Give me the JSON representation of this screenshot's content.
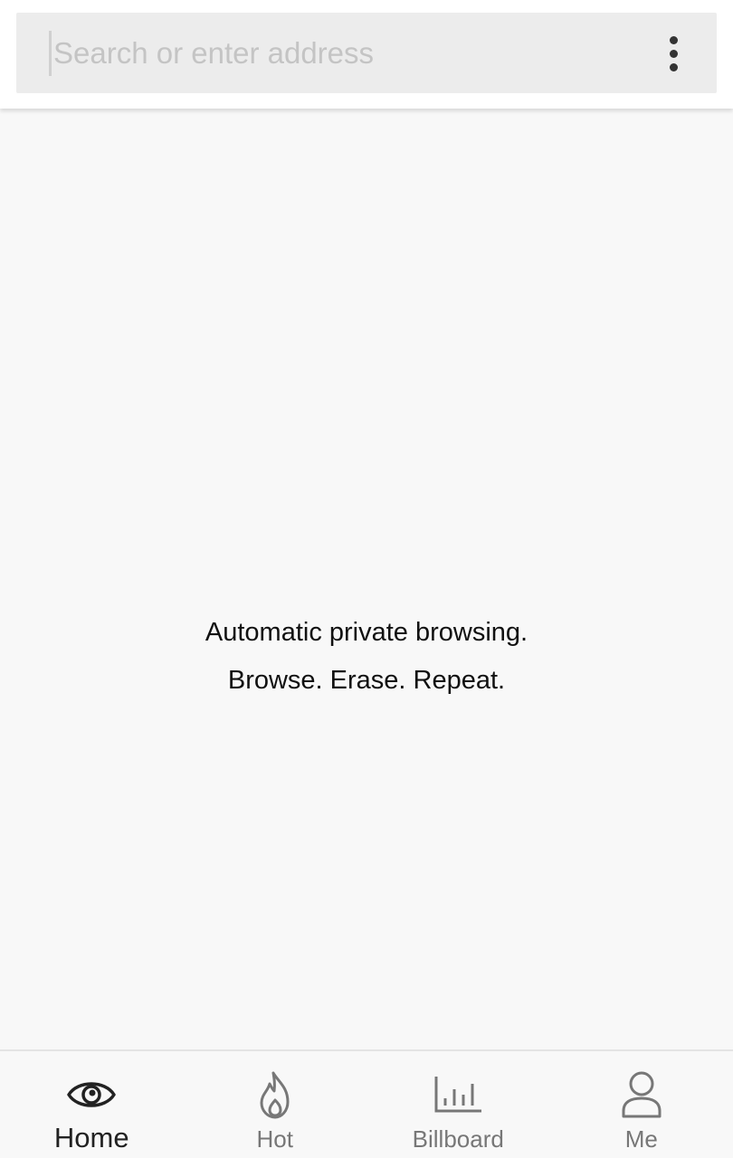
{
  "search": {
    "placeholder": "Search or enter address",
    "value": ""
  },
  "menu": {
    "icon": "more-vertical-icon"
  },
  "tagline": {
    "line1": "Automatic private browsing.",
    "line2": "Browse. Erase. Repeat."
  },
  "nav": {
    "items": [
      {
        "label": "Home",
        "icon": "eye-icon",
        "active": true
      },
      {
        "label": "Hot",
        "icon": "flame-icon",
        "active": false
      },
      {
        "label": "Billboard",
        "icon": "bar-chart-icon",
        "active": false
      },
      {
        "label": "Me",
        "icon": "user-icon",
        "active": false
      }
    ]
  },
  "colors": {
    "background": "#f8f8f8",
    "search_box": "#ececec",
    "active_text": "#222222",
    "inactive_text": "#777777"
  }
}
